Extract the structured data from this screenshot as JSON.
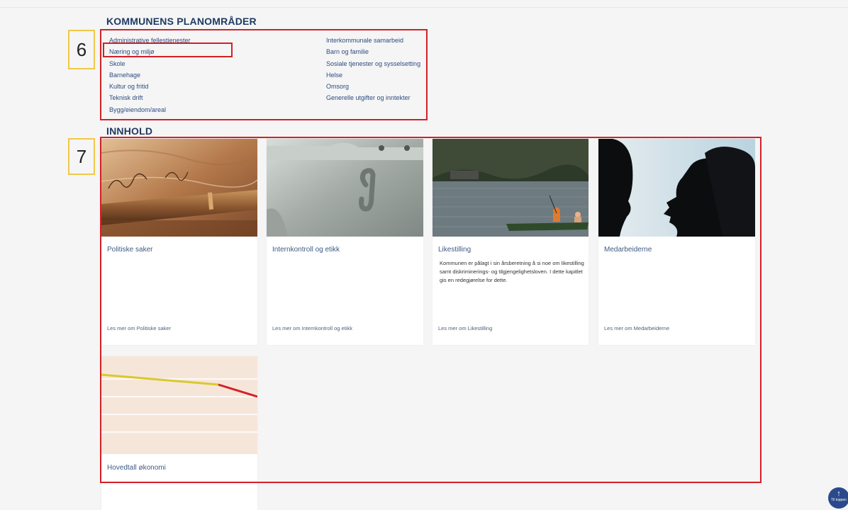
{
  "sections": {
    "planning_title": "KOMMUNENS PLANOMRÅDER",
    "content_title": "INNHOLD"
  },
  "callouts": {
    "six": "6",
    "seven": "7"
  },
  "planning_areas": {
    "left": [
      "Administrative fellestjenester",
      "Næring og miljø",
      "Skole",
      "Barnehage",
      "Kultur og fritid",
      "Teknisk drift",
      "Bygg/eiendom/areal"
    ],
    "right": [
      "Interkommunale samarbeid",
      "Barn og familie",
      "Sosiale tjenester og sysselsetting",
      "Helse",
      "Omsorg",
      "Generelle utgifter og inntekter"
    ]
  },
  "cards": [
    {
      "title": "Politiske saker",
      "description": "",
      "link": "Les mer om Politiske saker"
    },
    {
      "title": "Internkontroll og etikk",
      "description": "",
      "link": "Les mer om Internkontroll og etikk"
    },
    {
      "title": "Likestilling",
      "description": "Kommunen er pålagt i sin årsberetning å si noe om likestilling samt diskriminerings- og tilgjengelighetsloven. I dette kapitlet gis en redegjørelse for dette.",
      "link": "Les mer om Likestilling"
    },
    {
      "title": "Medarbeiderne",
      "description": "",
      "link": "Les mer om Medarbeiderne"
    },
    {
      "title": "Hovedtall økonomi",
      "description": "",
      "link": ""
    }
  ],
  "scroll_top": {
    "arrow": "↑",
    "label": "Til toppen"
  },
  "colors": {
    "accent": "#d42027",
    "callout_border": "#f0c84a",
    "title": "#1f3a63",
    "link": "#2d4d80",
    "scroll_button": "#2a4a8b"
  }
}
